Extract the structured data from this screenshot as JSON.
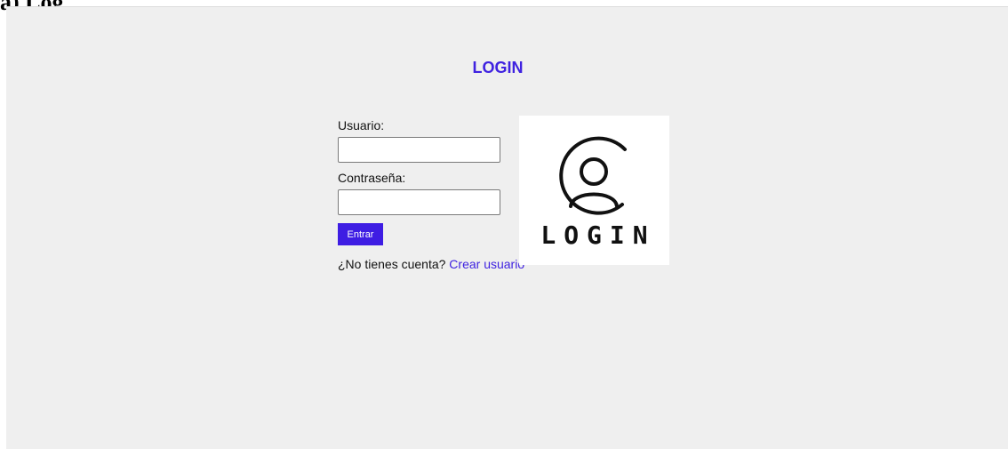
{
  "caption": "a) Log",
  "header": {
    "title": "LOGIN"
  },
  "form": {
    "username_label": "Usuario:",
    "username_value": "",
    "password_label": "Contraseña:",
    "password_value": "",
    "submit_label": "Entrar",
    "signup_prompt": "¿No tienes cuenta?",
    "signup_link": "Crear usuario"
  },
  "logo": {
    "text": "LOGIN",
    "icon": "user-circle-icon"
  },
  "colors": {
    "accent": "#3f22e0",
    "background": "#efefef",
    "button": "#3e1de3"
  }
}
